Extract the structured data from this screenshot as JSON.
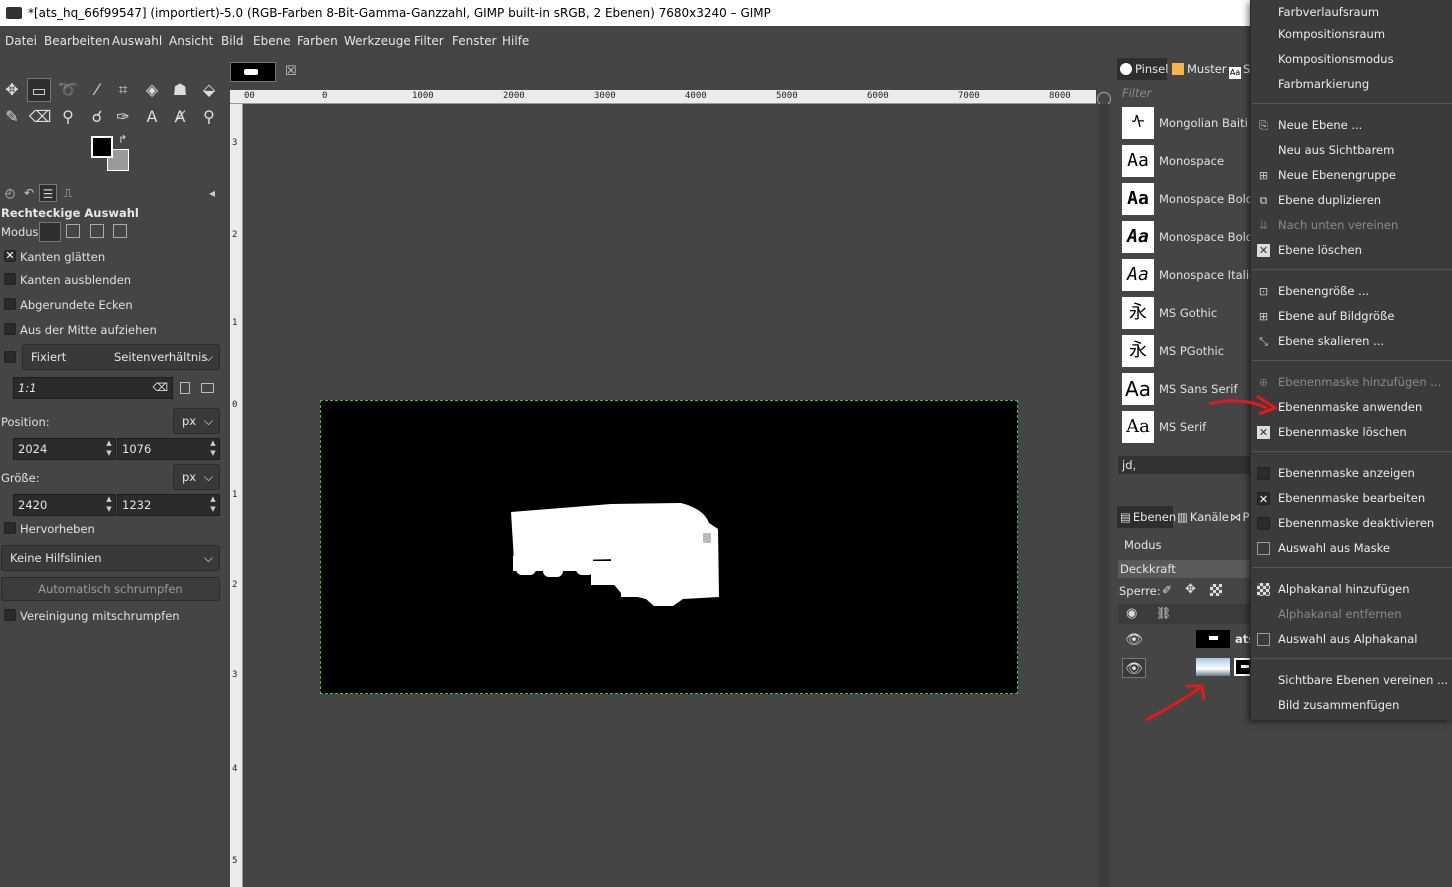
{
  "window": {
    "title": "*[ats_hq_66f99547] (importiert)-5.0 (RGB-Farben 8-Bit-Gamma-Ganzzahl, GIMP built-in sRGB, 2 Ebenen) 7680x3240 – GIMP"
  },
  "menubar": [
    "Datei",
    "Bearbeiten",
    "Auswahl",
    "Ansicht",
    "Bild",
    "Ebene",
    "Farben",
    "Werkzeuge",
    "Filter",
    "Fenster",
    "Hilfe"
  ],
  "toolbox": {
    "icons": [
      "move-icon",
      "rect-select-icon",
      "lasso-icon",
      "fuzzy-select-icon",
      "crop-icon",
      "transform-icon",
      "warp-icon",
      "bucket-fill-icon",
      "paintbrush-icon",
      "eraser-icon",
      "clone-icon",
      "smudge-icon",
      "paths-icon",
      "text-icon",
      "color-picker-icon",
      "zoom-icon"
    ],
    "foreground_color": "#000000",
    "background_color": "#9a9a9a"
  },
  "tool_options": {
    "title": "Rechteckige Auswahl",
    "mode_label": "Modus:",
    "antialias": {
      "label": "Kanten glätten",
      "checked": true
    },
    "feather": {
      "label": "Kanten ausblenden",
      "checked": false
    },
    "rounded": {
      "label": "Abgerundete Ecken",
      "checked": false
    },
    "expand_center": {
      "label": "Aus der Mitte aufziehen",
      "checked": false
    },
    "fixed": {
      "label": "Fixiert",
      "value": "Seitenverhältnis"
    },
    "ratio_value": "1:1",
    "position_label": "Position:",
    "position_unit": "px",
    "position_x": "2024",
    "position_y": "1076",
    "size_label": "Größe:",
    "size_unit": "px",
    "size_w": "2420",
    "size_h": "1232",
    "highlight": {
      "label": "Hervorheben",
      "checked": false
    },
    "guides": "Keine Hilfslinien",
    "auto_shrink": "Automatisch schrumpfen",
    "shrink_merged": {
      "label": "Vereinigung mitschrumpfen",
      "checked": false
    }
  },
  "ruler": {
    "h_ticks": [
      "00",
      "0",
      "1000",
      "2000",
      "3000",
      "4000",
      "5000",
      "6000",
      "7000",
      "8000"
    ],
    "v_ticks": [
      "3",
      "2",
      "1",
      "0",
      "1",
      "2",
      "3",
      "4",
      "5"
    ]
  },
  "dock": {
    "tabs": [
      "Pinsel",
      "Muster",
      "S"
    ],
    "font_filter_placeholder": "Filter",
    "fonts": [
      {
        "name": "Mongolian Baiti",
        "preview": "ᠰ"
      },
      {
        "name": "Monospace",
        "preview": "Aa"
      },
      {
        "name": "Monospace Bold",
        "preview": "Aa"
      },
      {
        "name": "Monospace Bold I",
        "preview": "Aa"
      },
      {
        "name": "Monospace Italic",
        "preview": "Aa"
      },
      {
        "name": "MS Gothic",
        "preview": "永"
      },
      {
        "name": "MS PGothic",
        "preview": "永"
      },
      {
        "name": "MS Sans Serif",
        "preview": "Aa"
      },
      {
        "name": "MS Serif",
        "preview": "Aa"
      }
    ],
    "font_entry": "jd,",
    "layer_tabs": [
      "Ebenen",
      "Kanäle",
      "P"
    ],
    "mode_label": "Modus",
    "opacity_label": "Deckkraft",
    "lock_label": "Sperre:",
    "layers": [
      {
        "name": "ats"
      },
      {
        "name": ""
      }
    ]
  },
  "context_menu": {
    "items": [
      {
        "label": "Farbverlaufsraum",
        "icon": "",
        "disabled": false
      },
      {
        "label": "Kompositionsraum",
        "icon": "",
        "disabled": false
      },
      {
        "label": "Kompositionsmodus",
        "icon": "",
        "disabled": false
      },
      {
        "label": "Farbmarkierung",
        "icon": "",
        "disabled": false
      },
      {
        "label": "Neue Ebene ...",
        "icon": "new-layer-icon",
        "disabled": false
      },
      {
        "label": "Neu aus Sichtbarem",
        "icon": "",
        "disabled": false
      },
      {
        "label": "Neue Ebenengruppe",
        "icon": "layer-group-icon",
        "disabled": false
      },
      {
        "label": "Ebene duplizieren",
        "icon": "duplicate-icon",
        "disabled": false
      },
      {
        "label": "Nach unten vereinen",
        "icon": "merge-down-icon",
        "disabled": true
      },
      {
        "label": "Ebene löschen",
        "icon": "delete-icon",
        "disabled": false
      },
      {
        "label": "Ebenengröße ...",
        "icon": "layer-size-icon",
        "disabled": false
      },
      {
        "label": "Ebene auf Bildgröße",
        "icon": "layer-to-image-icon",
        "disabled": false
      },
      {
        "label": "Ebene skalieren ...",
        "icon": "scale-icon",
        "disabled": false
      },
      {
        "label": "Ebenenmaske hinzufügen ...",
        "icon": "add-mask-icon",
        "disabled": true
      },
      {
        "label": "Ebenenmaske anwenden",
        "icon": "",
        "disabled": false
      },
      {
        "label": "Ebenenmaske löschen",
        "icon": "delete-icon",
        "disabled": false
      },
      {
        "label": "Ebenenmaske anzeigen",
        "icon": "checkbox-icon",
        "disabled": false
      },
      {
        "label": "Ebenenmaske bearbeiten",
        "icon": "checkbox-checked-icon",
        "disabled": false
      },
      {
        "label": "Ebenenmaske deaktivieren",
        "icon": "checkbox-icon",
        "disabled": false
      },
      {
        "label": "Auswahl aus Maske",
        "icon": "mask-to-selection-icon",
        "disabled": false
      },
      {
        "label": "Alphakanal hinzufügen",
        "icon": "alpha-icon",
        "disabled": false
      },
      {
        "label": "Alphakanal entfernen",
        "icon": "",
        "disabled": true
      },
      {
        "label": "Auswahl aus Alphakanal",
        "icon": "alpha-to-selection-icon",
        "disabled": false
      },
      {
        "label": "Sichtbare Ebenen vereinen ...",
        "icon": "",
        "disabled": false
      },
      {
        "label": "Bild zusammenfügen",
        "icon": "",
        "disabled": false
      }
    ]
  },
  "annotation_color": "#e0191e"
}
